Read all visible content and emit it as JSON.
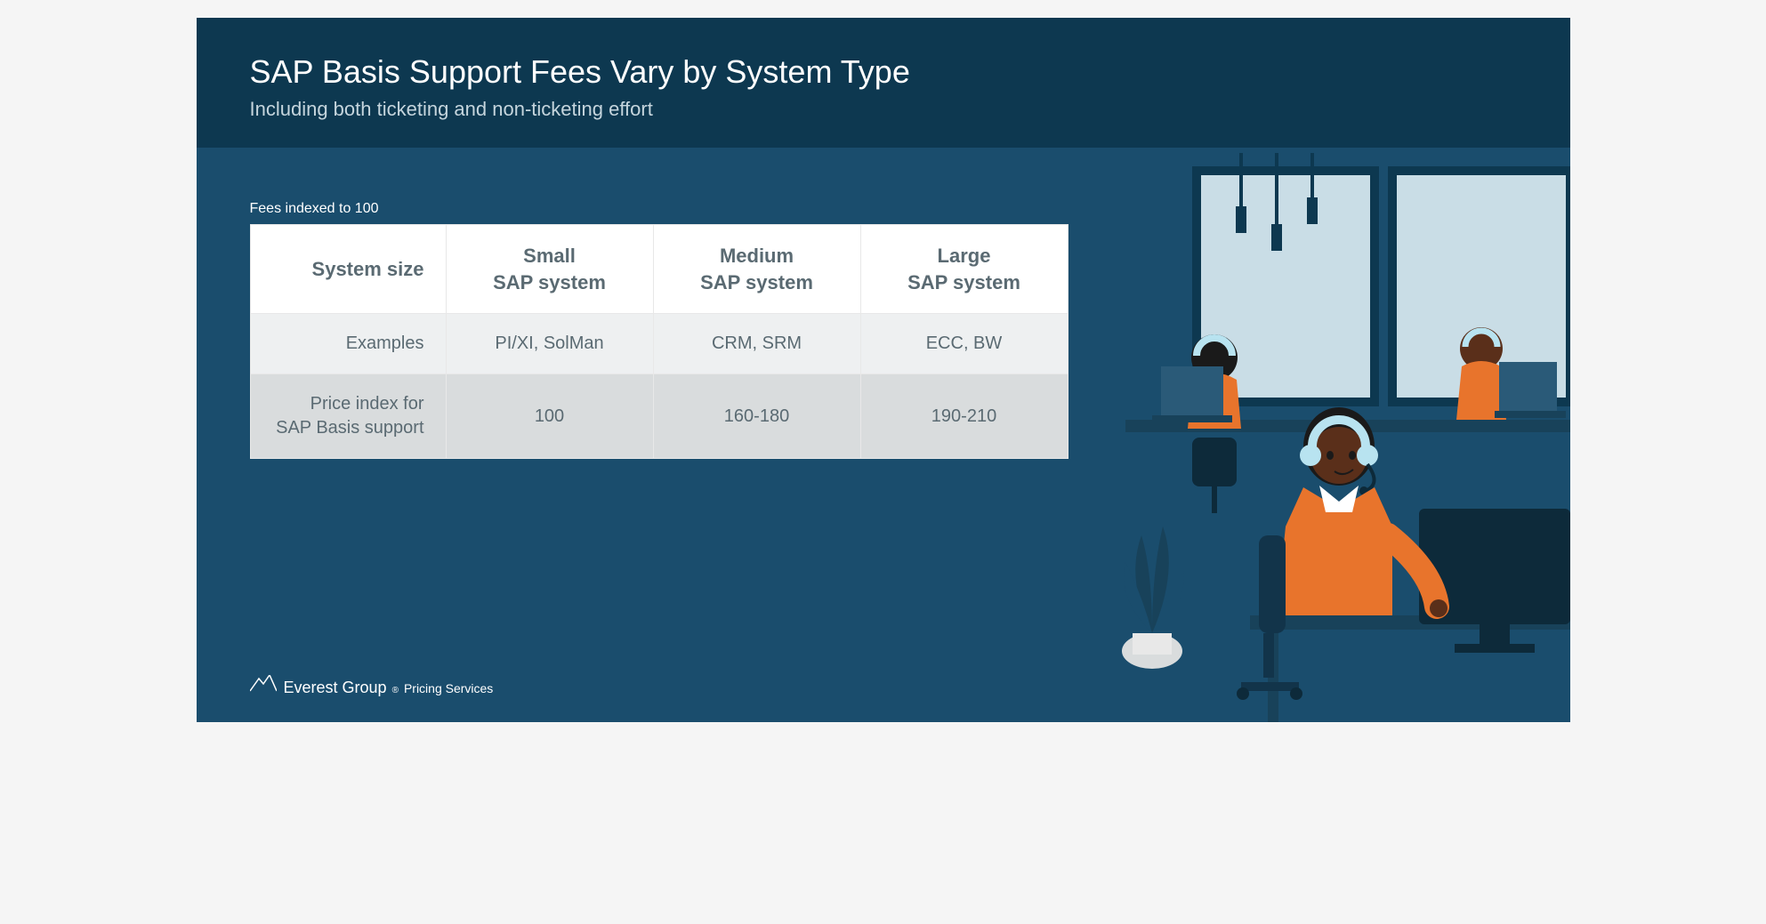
{
  "header": {
    "title": "SAP Basis Support Fees Vary by System Type",
    "subtitle": "Including both ticketing and non-ticketing effort"
  },
  "table": {
    "caption": "Fees indexed to 100",
    "corner_label": "System size",
    "columns": [
      "Small\nSAP system",
      "Medium\nSAP system",
      "Large\nSAP system"
    ],
    "rows": [
      {
        "label": "Examples",
        "cells": [
          "PI/XI, SolMan",
          "CRM, SRM",
          "ECC, BW"
        ]
      },
      {
        "label": "Price index for SAP Basis support",
        "cells": [
          "100",
          "160-180",
          "190-210"
        ]
      }
    ]
  },
  "footer": {
    "brand": "Everest Group",
    "reg": "®",
    "suffix": "Pricing Services"
  },
  "chart_data": {
    "type": "table",
    "title": "SAP Basis Support Fees Vary by System Type",
    "note": "Fees indexed to 100",
    "categories": [
      "Small SAP system",
      "Medium SAP system",
      "Large SAP system"
    ],
    "series": [
      {
        "name": "Examples",
        "values": [
          "PI/XI, SolMan",
          "CRM, SRM",
          "ECC, BW"
        ]
      },
      {
        "name": "Price index for SAP Basis support",
        "values": [
          "100",
          "160-180",
          "190-210"
        ]
      }
    ]
  }
}
